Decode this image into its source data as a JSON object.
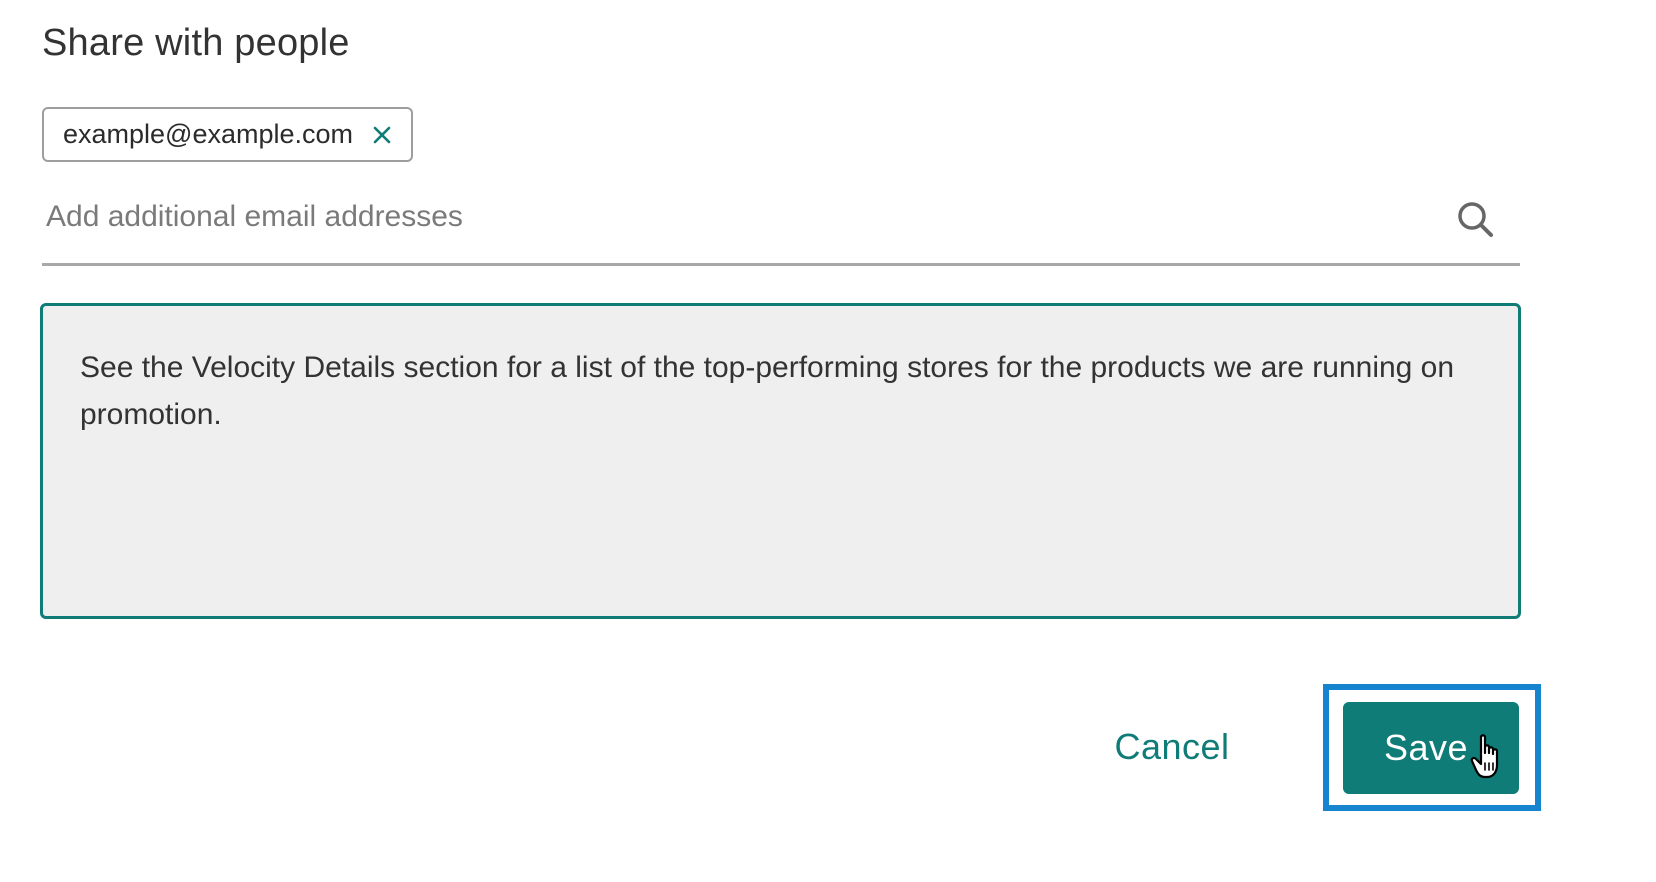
{
  "dialog": {
    "title": "Share with people"
  },
  "recipients": [
    {
      "email": "example@example.com",
      "remove_icon": "close-icon"
    }
  ],
  "email_field": {
    "value": "",
    "placeholder": "Add additional email addresses",
    "icon": "search-icon"
  },
  "message": {
    "text": "See the Velocity Details section for a list of the top-performing stores for the products we are running on promotion."
  },
  "actions": {
    "cancel_label": "Cancel",
    "save_label": "Save"
  },
  "colors": {
    "accent": "#0f7c78",
    "focus_ring": "#1784d0",
    "message_bg": "#efefef",
    "divider": "#a8a8a8"
  }
}
